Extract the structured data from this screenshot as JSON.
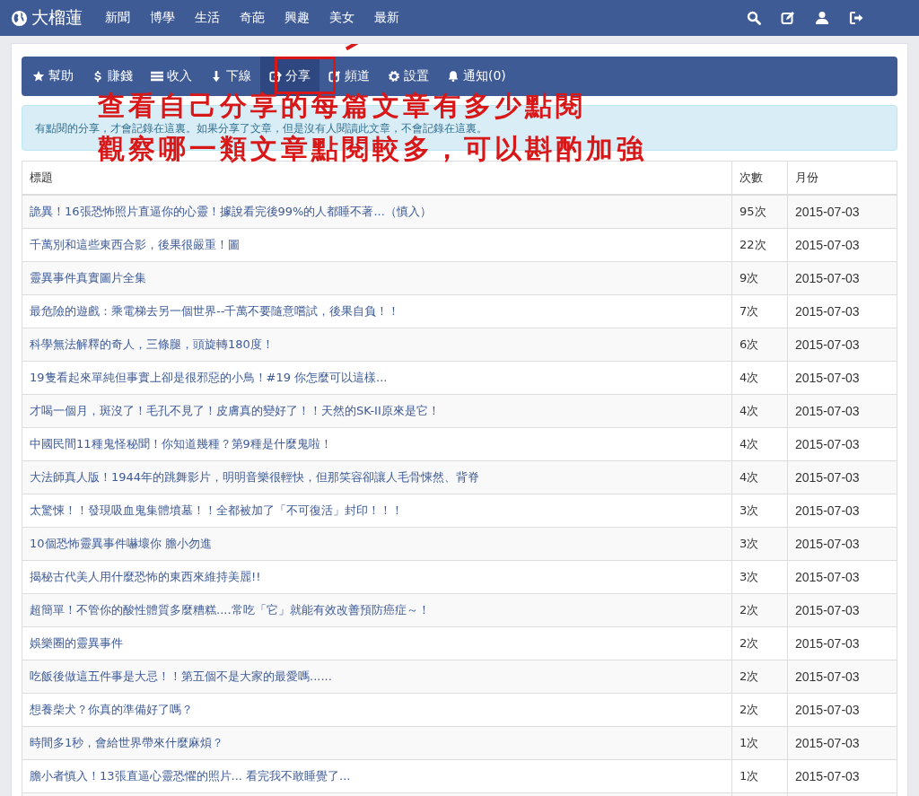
{
  "navbar": {
    "brand": "大榴蓮",
    "links": [
      "新聞",
      "博學",
      "生活",
      "奇葩",
      "興趣",
      "美女",
      "最新"
    ]
  },
  "toolbar": [
    {
      "label": "幫助",
      "kind": "star",
      "selected": false
    },
    {
      "label": "賺錢",
      "kind": "dollar",
      "selected": false
    },
    {
      "label": "收入",
      "kind": "list",
      "selected": false
    },
    {
      "label": "下線",
      "kind": "down",
      "selected": false
    },
    {
      "label": "分享",
      "kind": "share",
      "selected": true
    },
    {
      "label": "頻道",
      "kind": "edit",
      "selected": false
    },
    {
      "label": "設置",
      "kind": "gear",
      "selected": false
    },
    {
      "label": "通知(0)",
      "kind": "bell",
      "selected": false
    }
  ],
  "alert": "有點閱的分享，才會記錄在這裏。如果分享了文章，但是沒有人閱讀此文章，不會記錄在這裏。",
  "annotation": {
    "lines": [
      "查看自己分享的每篇文章有多少點閱",
      "觀察哪一類文章點閱較多，可以斟酌加強"
    ]
  },
  "table": {
    "columns": [
      "標題",
      "次數",
      "月份"
    ],
    "rows": [
      [
        "詭異！16張恐怖照片直逼你的心靈！據說看完後99%的人都睡不著...（慎入）",
        "95次",
        "2015-07-03"
      ],
      [
        "千萬別和這些東西合影，後果很嚴重！圖",
        "22次",
        "2015-07-03"
      ],
      [
        "靈異事件真實圖片全集",
        "9次",
        "2015-07-03"
      ],
      [
        "最危險的遊戲：乘電梯去另一個世界--千萬不要隨意嚐試，後果自負！！",
        "7次",
        "2015-07-03"
      ],
      [
        "科學無法解釋的奇人，三條腿，頭旋轉180度！",
        "6次",
        "2015-07-03"
      ],
      [
        "19隻看起來單純但事實上卻是很邪惡的小鳥！#19 你怎麼可以這樣...",
        "4次",
        "2015-07-03"
      ],
      [
        "才喝一個月，斑沒了！毛孔不見了！皮膚真的變好了！！天然的SK-II原來是它！",
        "4次",
        "2015-07-03"
      ],
      [
        "中國民間11種鬼怪秘聞！你知道幾種？第9種是什麼鬼啦！",
        "4次",
        "2015-07-03"
      ],
      [
        "大法師真人版！1944年的跳舞影片，明明音樂很輕快，但那笑容卻讓人毛骨悚然、背脊",
        "4次",
        "2015-07-03"
      ],
      [
        "太驚悚！！發現吸血鬼集體墳墓！！全都被加了「不可復活」封印！！！",
        "3次",
        "2015-07-03"
      ],
      [
        "10個恐怖靈異事件嚇壞你 膽小勿進",
        "3次",
        "2015-07-03"
      ],
      [
        "揭秘古代美人用什麼恐怖的東西來維持美麗!!",
        "3次",
        "2015-07-03"
      ],
      [
        "超簡單！不管你的酸性體質多麼糟糕....常吃「它」就能有效改善預防癌症～！",
        "2次",
        "2015-07-03"
      ],
      [
        "娛樂圈的靈異事件",
        "2次",
        "2015-07-03"
      ],
      [
        "吃飯後做這五件事是大忌！！第五個不是大家的最愛嗎......",
        "2次",
        "2015-07-03"
      ],
      [
        "想養柴犬？你真的準備好了嗎？",
        "2次",
        "2015-07-03"
      ],
      [
        "時間多1秒，會給世界帶來什麼麻煩？",
        "1次",
        "2015-07-03"
      ],
      [
        "膽小者慎入！13張直逼心靈恐懼的照片... 看完我不敢睡覺了...",
        "1次",
        "2015-07-03"
      ]
    ]
  }
}
